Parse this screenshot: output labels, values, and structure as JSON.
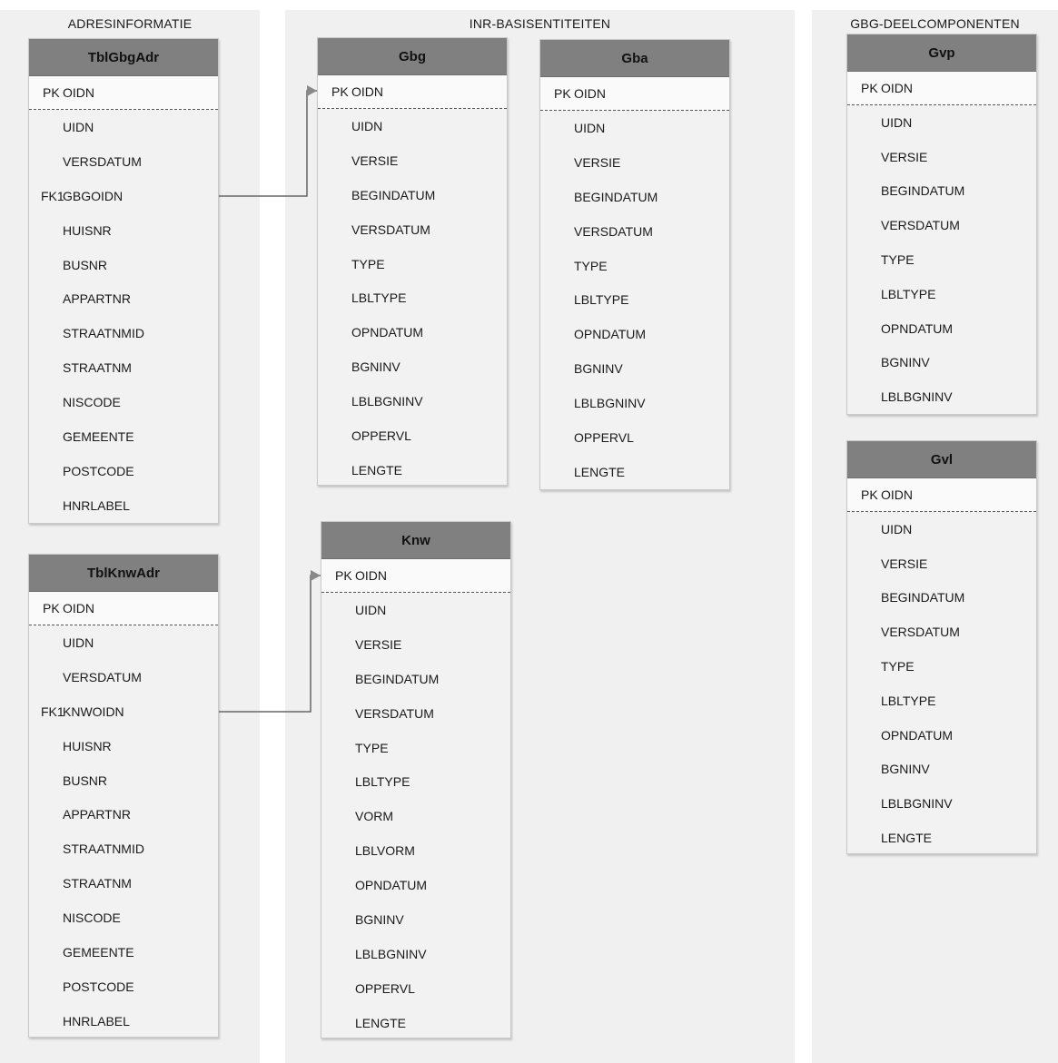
{
  "groups": {
    "adres": "ADRESINFORMATIE",
    "inr": "INR-BASISENTITEITEN",
    "gbg": "GBG-DEELCOMPONENTEN"
  },
  "entities": {
    "tblgbgadr": {
      "name": "TblGbgAdr",
      "pk": {
        "key": "PK",
        "name": "OIDN"
      },
      "attributes": [
        {
          "key": "",
          "name": "UIDN"
        },
        {
          "key": "",
          "name": "VERSDATUM"
        },
        {
          "key": "FK1",
          "name": "GBGOIDN"
        },
        {
          "key": "",
          "name": "HUISNR"
        },
        {
          "key": "",
          "name": "BUSNR"
        },
        {
          "key": "",
          "name": "APPARTNR"
        },
        {
          "key": "",
          "name": "STRAATNMID"
        },
        {
          "key": "",
          "name": "STRAATNM"
        },
        {
          "key": "",
          "name": "NISCODE"
        },
        {
          "key": "",
          "name": "GEMEENTE"
        },
        {
          "key": "",
          "name": "POSTCODE"
        },
        {
          "key": "",
          "name": "HNRLABEL"
        }
      ]
    },
    "tblknwadr": {
      "name": "TblKnwAdr",
      "pk": {
        "key": "PK",
        "name": "OIDN"
      },
      "attributes": [
        {
          "key": "",
          "name": "UIDN"
        },
        {
          "key": "",
          "name": "VERSDATUM"
        },
        {
          "key": "FK1",
          "name": "KNWOIDN"
        },
        {
          "key": "",
          "name": "HUISNR"
        },
        {
          "key": "",
          "name": "BUSNR"
        },
        {
          "key": "",
          "name": "APPARTNR"
        },
        {
          "key": "",
          "name": "STRAATNMID"
        },
        {
          "key": "",
          "name": "STRAATNM"
        },
        {
          "key": "",
          "name": "NISCODE"
        },
        {
          "key": "",
          "name": "GEMEENTE"
        },
        {
          "key": "",
          "name": "POSTCODE"
        },
        {
          "key": "",
          "name": "HNRLABEL"
        }
      ]
    },
    "gbg": {
      "name": "Gbg",
      "pk": {
        "key": "PK",
        "name": "OIDN"
      },
      "attributes": [
        {
          "key": "",
          "name": "UIDN"
        },
        {
          "key": "",
          "name": "VERSIE"
        },
        {
          "key": "",
          "name": "BEGINDATUM"
        },
        {
          "key": "",
          "name": "VERSDATUM"
        },
        {
          "key": "",
          "name": "TYPE"
        },
        {
          "key": "",
          "name": "LBLTYPE"
        },
        {
          "key": "",
          "name": "OPNDATUM"
        },
        {
          "key": "",
          "name": "BGNINV"
        },
        {
          "key": "",
          "name": "LBLBGNINV"
        },
        {
          "key": "",
          "name": "OPPERVL"
        },
        {
          "key": "",
          "name": "LENGTE"
        }
      ]
    },
    "gba": {
      "name": "Gba",
      "pk": {
        "key": "PK",
        "name": "OIDN"
      },
      "attributes": [
        {
          "key": "",
          "name": "UIDN"
        },
        {
          "key": "",
          "name": "VERSIE"
        },
        {
          "key": "",
          "name": "BEGINDATUM"
        },
        {
          "key": "",
          "name": "VERSDATUM"
        },
        {
          "key": "",
          "name": "TYPE"
        },
        {
          "key": "",
          "name": "LBLTYPE"
        },
        {
          "key": "",
          "name": "OPNDATUM"
        },
        {
          "key": "",
          "name": "BGNINV"
        },
        {
          "key": "",
          "name": "LBLBGNINV"
        },
        {
          "key": "",
          "name": "OPPERVL"
        },
        {
          "key": "",
          "name": "LENGTE"
        }
      ]
    },
    "knw": {
      "name": "Knw",
      "pk": {
        "key": "PK",
        "name": "OIDN"
      },
      "attributes": [
        {
          "key": "",
          "name": "UIDN"
        },
        {
          "key": "",
          "name": "VERSIE"
        },
        {
          "key": "",
          "name": "BEGINDATUM"
        },
        {
          "key": "",
          "name": "VERSDATUM"
        },
        {
          "key": "",
          "name": "TYPE"
        },
        {
          "key": "",
          "name": "LBLTYPE"
        },
        {
          "key": "",
          "name": "VORM"
        },
        {
          "key": "",
          "name": "LBLVORM"
        },
        {
          "key": "",
          "name": "OPNDATUM"
        },
        {
          "key": "",
          "name": "BGNINV"
        },
        {
          "key": "",
          "name": "LBLBGNINV"
        },
        {
          "key": "",
          "name": "OPPERVL"
        },
        {
          "key": "",
          "name": "LENGTE"
        }
      ]
    },
    "gvp": {
      "name": "Gvp",
      "pk": {
        "key": "PK",
        "name": "OIDN"
      },
      "attributes": [
        {
          "key": "",
          "name": "UIDN"
        },
        {
          "key": "",
          "name": "VERSIE"
        },
        {
          "key": "",
          "name": "BEGINDATUM"
        },
        {
          "key": "",
          "name": "VERSDATUM"
        },
        {
          "key": "",
          "name": "TYPE"
        },
        {
          "key": "",
          "name": "LBLTYPE"
        },
        {
          "key": "",
          "name": "OPNDATUM"
        },
        {
          "key": "",
          "name": "BGNINV"
        },
        {
          "key": "",
          "name": "LBLBGNINV"
        }
      ]
    },
    "gvl": {
      "name": "Gvl",
      "pk": {
        "key": "PK",
        "name": "OIDN"
      },
      "attributes": [
        {
          "key": "",
          "name": "UIDN"
        },
        {
          "key": "",
          "name": "VERSIE"
        },
        {
          "key": "",
          "name": "BEGINDATUM"
        },
        {
          "key": "",
          "name": "VERSDATUM"
        },
        {
          "key": "",
          "name": "TYPE"
        },
        {
          "key": "",
          "name": "LBLTYPE"
        },
        {
          "key": "",
          "name": "OPNDATUM"
        },
        {
          "key": "",
          "name": "BGNINV"
        },
        {
          "key": "",
          "name": "LBLBGNINV"
        },
        {
          "key": "",
          "name": "LENGTE"
        }
      ]
    }
  },
  "relationships": [
    {
      "from": "tblgbgadr",
      "from_attr": "GBGOIDN",
      "to": "gbg",
      "to_attr": "OIDN"
    },
    {
      "from": "tblknwadr",
      "from_attr": "KNWOIDN",
      "to": "knw",
      "to_attr": "OIDN"
    }
  ]
}
